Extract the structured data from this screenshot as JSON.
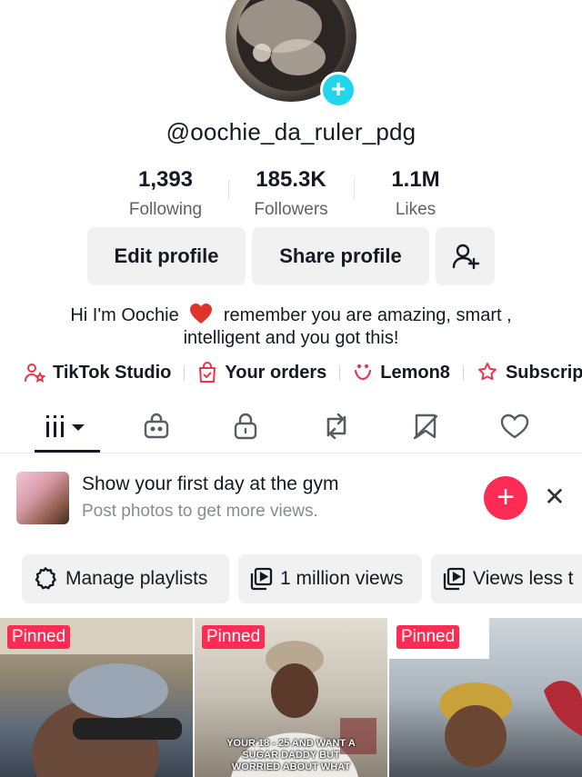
{
  "profile": {
    "username": "@oochie_da_ruler_pdg",
    "avatar_badge_icon": "plus-icon",
    "stats": [
      {
        "value": "1,393",
        "label": "Following"
      },
      {
        "value": "185.3K",
        "label": "Followers"
      },
      {
        "value": "1.1M",
        "label": "Likes"
      }
    ],
    "buttons": {
      "edit": "Edit profile",
      "share": "Share profile",
      "add_friends_icon": "add-user-icon"
    },
    "bio_line1_a": "Hi I'm Oochie",
    "bio_line1_b": "remember you are amazing, smart ,",
    "bio_line2": "intelligent and you got this!",
    "links": [
      {
        "label": "TikTok Studio",
        "icon": "studio-icon"
      },
      {
        "label": "Your orders",
        "icon": "bag-icon"
      },
      {
        "label": "Lemon8",
        "icon": "lemon8-icon"
      },
      {
        "label": "Subscript",
        "icon": "subscription-icon"
      }
    ]
  },
  "tabs": [
    "videos-grid-icon",
    "shop-icon",
    "lock-icon",
    "repost-icon",
    "favorites-icon",
    "liked-icon"
  ],
  "promo": {
    "title": "Show your first day at the gym",
    "subtitle": "Post photos to get more views."
  },
  "chips": [
    {
      "label": "Manage playlists",
      "icon": "gear-icon"
    },
    {
      "label": "1 million views",
      "icon": "playlist-icon"
    },
    {
      "label": "Views less t",
      "icon": "playlist-icon"
    }
  ],
  "videos": [
    {
      "badge": "Pinned",
      "caption": ""
    },
    {
      "badge": "Pinned",
      "caption": "YOUR 18 - 25 AND WANT A SUGAR DADDY BUT WORRIED ABOUT WHAT"
    },
    {
      "badge": "Pinned",
      "caption": ""
    }
  ],
  "colors": {
    "accent": "#fe2c55",
    "badge_blue": "#20d5ec",
    "chip_bg": "#f1f1f2"
  }
}
